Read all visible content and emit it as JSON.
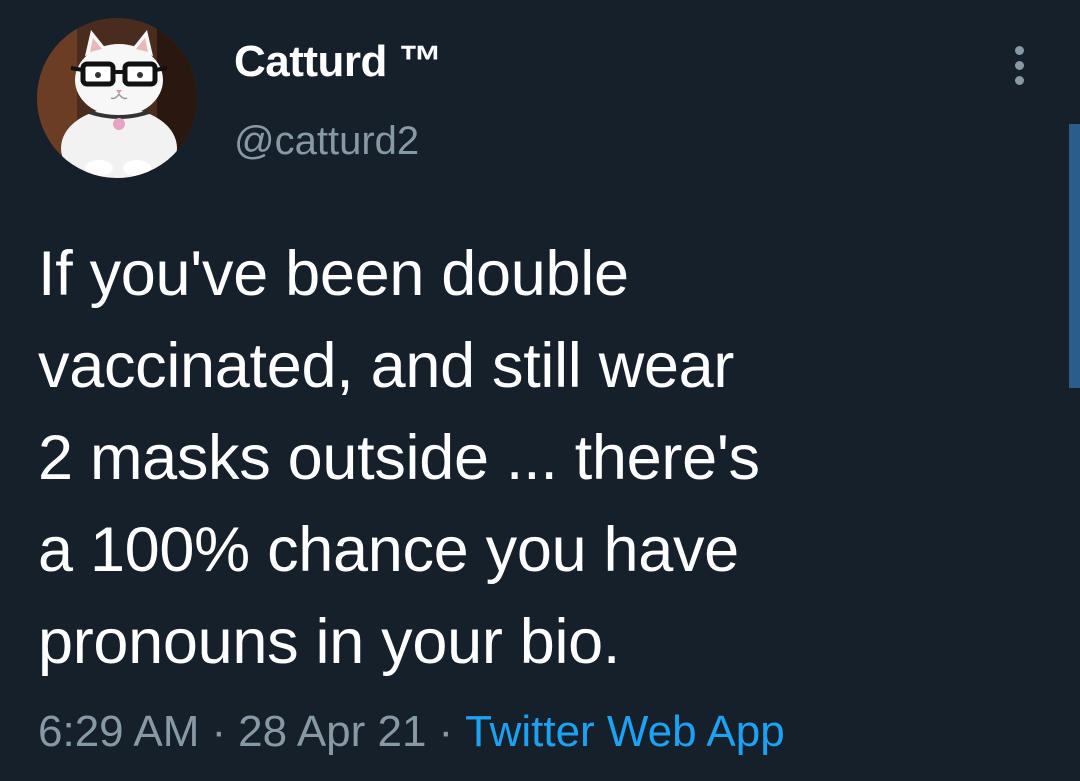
{
  "user": {
    "display_name": "Catturd ™",
    "handle": "@catturd2",
    "avatar_icon": "cat-with-glasses-avatar"
  },
  "tweet": {
    "lines": [
      "If you've been double",
      "vaccinated, and still wear",
      "2 masks outside ... there's",
      "a 100% chance you have",
      "pronouns in your bio."
    ],
    "time": "6:29 AM",
    "separator": "·",
    "date": "28 Apr 21",
    "source": "Twitter Web App"
  },
  "colors": {
    "background": "#15202b",
    "text": "#ffffff",
    "secondary": "#8899a6",
    "link": "#1da1f2"
  },
  "icons": {
    "more": "more-vertical-icon"
  }
}
